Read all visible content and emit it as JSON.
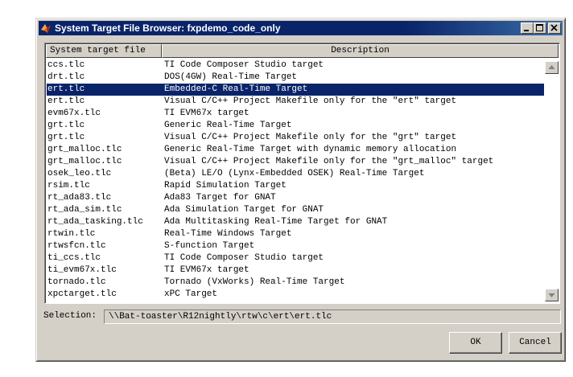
{
  "window": {
    "title": "System Target File Browser: fxpdemo_code_only",
    "icon": "matlab-icon",
    "controls": [
      "minimize-icon",
      "maximize-icon",
      "close-icon"
    ]
  },
  "table": {
    "headers": {
      "file": "System target file",
      "description": "Description"
    },
    "selected_index": 2,
    "rows": [
      {
        "file": "ccs.tlc",
        "description": "TI Code Composer Studio target"
      },
      {
        "file": "drt.tlc",
        "description": "DOS(4GW) Real-Time Target"
      },
      {
        "file": "ert.tlc",
        "description": "Embedded-C Real-Time Target"
      },
      {
        "file": "ert.tlc",
        "description": "Visual C/C++ Project Makefile only for the \"ert\" target"
      },
      {
        "file": "evm67x.tlc",
        "description": "TI EVM67x target"
      },
      {
        "file": "grt.tlc",
        "description": "Generic Real-Time Target"
      },
      {
        "file": "grt.tlc",
        "description": "Visual C/C++ Project Makefile only for the \"grt\" target"
      },
      {
        "file": "grt_malloc.tlc",
        "description": "Generic Real-Time Target with dynamic memory allocation"
      },
      {
        "file": "grt_malloc.tlc",
        "description": "Visual C/C++ Project Makefile only for the \"grt_malloc\" target"
      },
      {
        "file": "osek_leo.tlc",
        "description": "(Beta) LE/O (Lynx-Embedded OSEK) Real-Time Target"
      },
      {
        "file": "rsim.tlc",
        "description": "Rapid Simulation Target"
      },
      {
        "file": "rt_ada83.tlc",
        "description": "Ada83 Target for GNAT"
      },
      {
        "file": "rt_ada_sim.tlc",
        "description": "Ada Simulation Target for GNAT"
      },
      {
        "file": "rt_ada_tasking.tlc",
        "description": "Ada Multitasking Real-Time Target for GNAT"
      },
      {
        "file": "rtwin.tlc",
        "description": "Real-Time Windows Target"
      },
      {
        "file": "rtwsfcn.tlc",
        "description": "S-function Target"
      },
      {
        "file": "ti_ccs.tlc",
        "description": "TI Code Composer Studio target"
      },
      {
        "file": "ti_evm67x.tlc",
        "description": "TI EVM67x target"
      },
      {
        "file": "tornado.tlc",
        "description": "Tornado (VxWorks) Real-Time Target"
      },
      {
        "file": "xpctarget.tlc",
        "description": "xPC Target"
      }
    ]
  },
  "selection": {
    "label": "Selection:",
    "value": "\\\\Bat-toaster\\R12nightly\\rtw\\c\\ert\\ert.tlc"
  },
  "buttons": {
    "ok": "OK",
    "cancel": "Cancel"
  },
  "colors": {
    "selection_bg": "#0a246a",
    "titlebar": "#0a246a",
    "face": "#d4d0c8"
  }
}
